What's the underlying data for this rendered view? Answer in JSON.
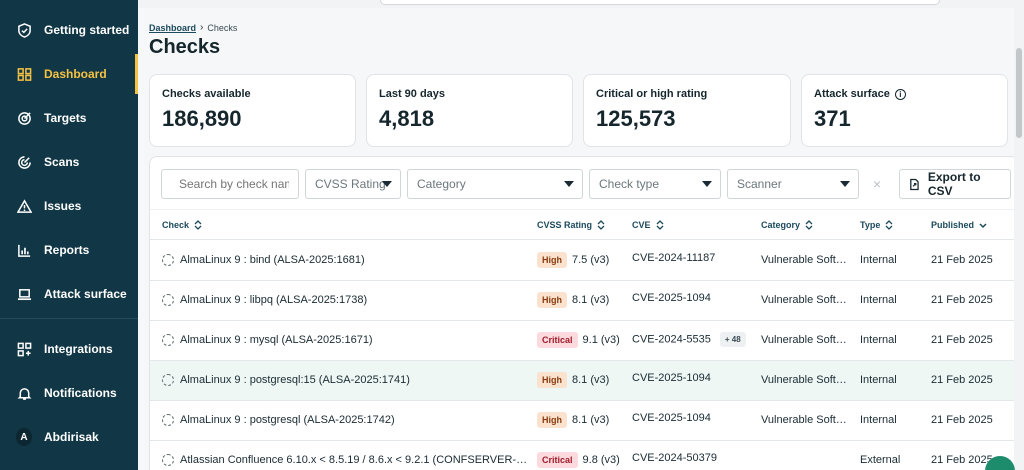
{
  "sidebar": {
    "items": [
      {
        "label": "Getting started",
        "icon": "shield-check-icon"
      },
      {
        "label": "Dashboard",
        "icon": "dashboard-icon",
        "active": true
      },
      {
        "label": "Targets",
        "icon": "target-icon"
      },
      {
        "label": "Scans",
        "icon": "radar-icon"
      },
      {
        "label": "Issues",
        "icon": "warning-triangle-icon"
      },
      {
        "label": "Reports",
        "icon": "bar-chart-icon"
      },
      {
        "label": "Attack surface",
        "icon": "laptop-icon"
      },
      {
        "label": "Integrations",
        "icon": "grid-plus-icon"
      },
      {
        "label": "Notifications",
        "icon": "bell-icon"
      }
    ],
    "user": {
      "initial": "A",
      "name": "Abdirisak"
    },
    "active_color": "#f6c243",
    "bg_color": "#113645"
  },
  "breadcrumb": {
    "root": "Dashboard",
    "current": "Checks"
  },
  "page_title": "Checks",
  "stats": [
    {
      "title": "Checks available",
      "value": "186,890"
    },
    {
      "title": "Last 90 days",
      "value": "4,818"
    },
    {
      "title": "Critical or high rating",
      "value": "125,573"
    },
    {
      "title": "Attack surface",
      "value": "371",
      "info": true
    }
  ],
  "filters": {
    "search_placeholder": "Search by check name",
    "cvss": "CVSS Rating",
    "category": "Category",
    "check_type": "Check type",
    "scanner": "Scanner",
    "clear": "×",
    "export": "Export to CSV"
  },
  "table": {
    "columns": [
      "Check",
      "CVSS Rating",
      "CVE",
      "Category",
      "Type",
      "Published"
    ],
    "rows": [
      {
        "check": "AlmaLinux 9 : bind (ALSA-2025:1681)",
        "severity": "High",
        "score": "7.5 (v3)",
        "cve": "CVE-2024-11187",
        "more": "",
        "category": "Vulnerable Soft…",
        "type": "Internal",
        "published": "21 Feb 2025"
      },
      {
        "check": "AlmaLinux 9 : libpq (ALSA-2025:1738)",
        "severity": "High",
        "score": "8.1 (v3)",
        "cve": "CVE-2025-1094",
        "more": "",
        "category": "Vulnerable Soft…",
        "type": "Internal",
        "published": "21 Feb 2025"
      },
      {
        "check": "AlmaLinux 9 : mysql (ALSA-2025:1671)",
        "severity": "Critical",
        "score": "9.1 (v3)",
        "cve": "CVE-2024-5535",
        "more": "+ 48",
        "category": "Vulnerable Soft…",
        "type": "Internal",
        "published": "21 Feb 2025"
      },
      {
        "check": "AlmaLinux 9 : postgresql:15 (ALSA-2025:1741)",
        "severity": "High",
        "score": "8.1 (v3)",
        "cve": "CVE-2025-1094",
        "more": "",
        "category": "Vulnerable Soft…",
        "type": "Internal",
        "published": "21 Feb 2025",
        "highlighted": true
      },
      {
        "check": "AlmaLinux 9 : postgresql (ALSA-2025:1742)",
        "severity": "High",
        "score": "8.1 (v3)",
        "cve": "CVE-2025-1094",
        "more": "",
        "category": "Vulnerable Soft…",
        "type": "Internal",
        "published": "21 Feb 2025"
      },
      {
        "check": "Atlassian Confluence 6.10.x < 8.5.19 / 8.6.x < 9.2.1 (CONFSERVER-…",
        "severity": "Critical",
        "score": "9.8 (v3)",
        "cve": "CVE-2024-50379",
        "more": "",
        "category": "",
        "type": "External",
        "published": "21 Feb 2025"
      }
    ]
  }
}
